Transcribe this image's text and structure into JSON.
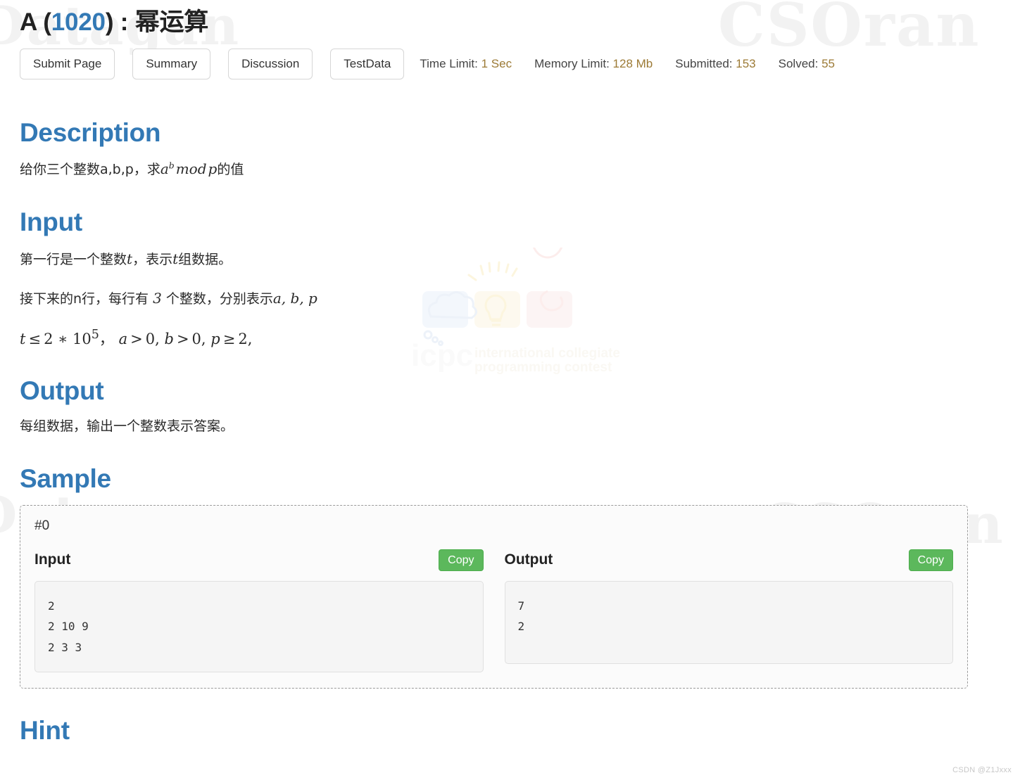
{
  "title": {
    "letter": "A (",
    "problem_id": "1020",
    "suffix": ") : ",
    "name": "幂运算",
    "accent_color": "#3379b5"
  },
  "toolbar": {
    "buttons": [
      {
        "label": "Submit Page",
        "name": "submit-page"
      },
      {
        "label": "Summary",
        "name": "summary"
      },
      {
        "label": "Discussion",
        "name": "discussion"
      },
      {
        "label": "TestData",
        "name": "testdata"
      }
    ],
    "stats": [
      {
        "label": "Time Limit: ",
        "value": "1 Sec"
      },
      {
        "label": "Memory Limit: ",
        "value": "128 Mb"
      },
      {
        "label": "Submitted: ",
        "value": "153"
      },
      {
        "label": "Solved: ",
        "value": "55"
      }
    ],
    "stat_value_color": "#9c7a35"
  },
  "sections": {
    "description": {
      "heading": "Description",
      "text_before": "给你三个整数a,b,p，求",
      "math_base": "a",
      "math_exp": "b",
      "math_mod": "mod",
      "math_p": "p",
      "text_after": "的值"
    },
    "input": {
      "heading": "Input",
      "line1_before": "第一行是一个整数",
      "line1_var1": "t",
      "line1_mid": "，表示",
      "line1_var2": "t",
      "line1_after": "组数据。",
      "line2_before": "接下来的n行，每行有 ",
      "line2_num": "3",
      "line2_mid": " 个整数，分别表示",
      "line2_vars": "a, b, p",
      "constraint": {
        "t": "t",
        "le": "≤",
        "bound": "2 ∗ 10",
        "exp": "5",
        "comma": "，",
        "a": "a",
        "gt1": ">",
        "zero1": "0,",
        "b": "b",
        "gt2": ">",
        "zero2": "0,",
        "p": "p",
        "ge": "≥",
        "two": "2,"
      }
    },
    "output": {
      "heading": "Output",
      "text": "每组数据，输出一个整数表示答案。"
    },
    "sample": {
      "heading": "Sample",
      "case_id": "#0",
      "input_label": "Input",
      "output_label": "Output",
      "copy_label": "Copy",
      "copy_color": "#5cb85c",
      "input_text": "2\n2 10 9\n2 3 3",
      "output_text": "7\n2"
    },
    "hint": {
      "heading": "Hint"
    }
  },
  "watermarks": {
    "gothic": "CSOran",
    "gothic_left": "Datagan",
    "icpc_line1": "international collegiate",
    "icpc_line2": "programming contest",
    "icpc_word": "icpc",
    "csdn": "CSDN @Z1Jxxx"
  }
}
